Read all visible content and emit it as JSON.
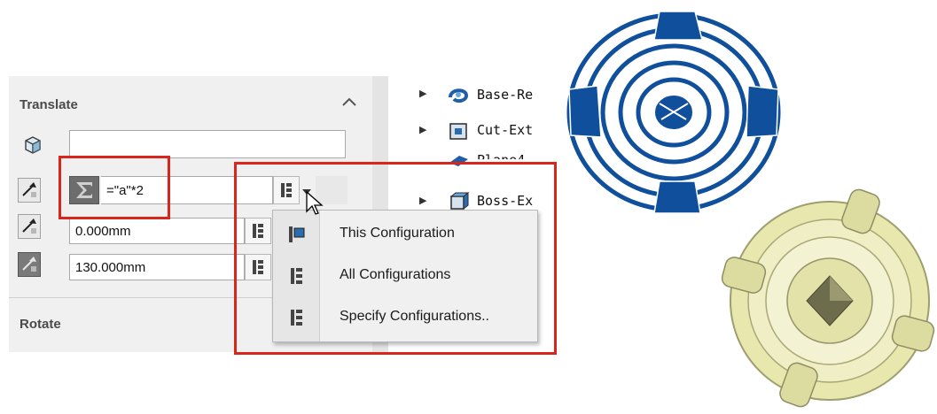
{
  "translate": {
    "title": "Translate",
    "name_value": "",
    "equation_value": "=\"a\"*2",
    "y_value": "0.000mm",
    "z_value": "130.000mm"
  },
  "rotate": {
    "title": "Rotate"
  },
  "config_menu": {
    "items": [
      {
        "label": "This Configuration",
        "icon": "this-configuration-icon"
      },
      {
        "label": "All Configurations",
        "icon": "all-configurations-icon"
      },
      {
        "label": "Specify Configurations..",
        "icon": "specify-configurations-icon"
      }
    ]
  },
  "feature_tree": {
    "items": [
      {
        "label": "Base-Re",
        "icon": "revolve-feature-icon"
      },
      {
        "label": "Cut-Ext",
        "icon": "cut-extrude-icon"
      },
      {
        "label": "Plane4",
        "icon": "plane-icon"
      },
      {
        "label": "Boss-Ex",
        "icon": "boss-extrude-icon"
      }
    ]
  },
  "colors": {
    "highlight_red": "#d9261c",
    "wireframe_blue": "#0f4f9c",
    "shaded_part": "#ecebb5"
  }
}
